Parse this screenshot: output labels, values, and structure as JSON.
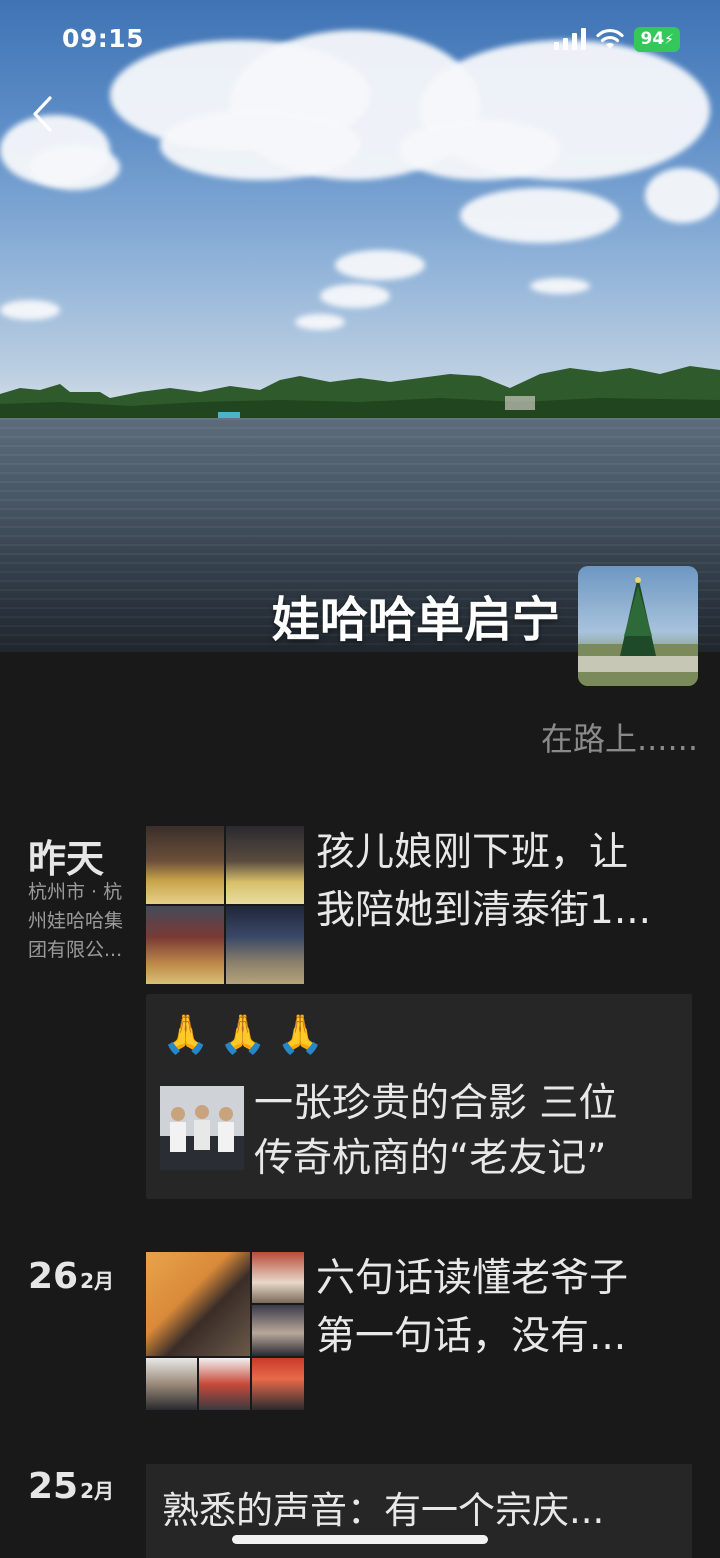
{
  "status_bar": {
    "time": "09:15",
    "battery": "94"
  },
  "profile": {
    "name": "娃哈哈单启宁",
    "signature": "在路上......"
  },
  "posts": [
    {
      "date": "昨天",
      "location": "杭州市 · 杭州娃哈哈集团有限公...",
      "text_line1": "孩儿娘刚下班，让",
      "text_line2": "我陪她到清泰街1...",
      "share": {
        "emojis": [
          "🙏",
          "🙏",
          "🙏"
        ],
        "title_line1": "一张珍贵的合影 三位",
        "title_line2": "传奇杭商的“老友记”"
      }
    },
    {
      "day": "26",
      "month": "2月",
      "text_line1": "六句话读懂老爷子",
      "text_line2": "第一句话，没有..."
    },
    {
      "day": "25",
      "month": "2月",
      "music_title": "熟悉的声音：有一个宗庆..."
    }
  ],
  "icons": [
    "back-chevron-icon",
    "signal-icon",
    "wifi-icon",
    "battery-icon",
    "folded-hands-emoji"
  ]
}
